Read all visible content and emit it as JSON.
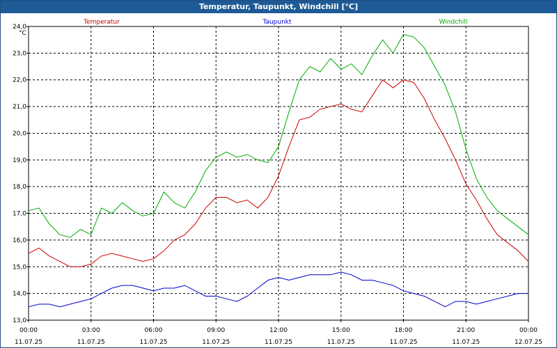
{
  "window": {
    "title": "Temperatur, Taupunkt, Windchill [°C]"
  },
  "colors": {
    "title_bg": "#1e5a96",
    "temperatur": "#cc0000",
    "taupunkt": "#0000cc",
    "windchill": "#00aa00",
    "grid": "#000000"
  },
  "chart_data": {
    "type": "line",
    "title": "Temperatur, Taupunkt, Windchill [°C]",
    "ylabel": "°C",
    "ylim": [
      13.0,
      24.0
    ],
    "yticks": [
      "13,0",
      "14,0",
      "15,0",
      "16,0",
      "17,0",
      "18,0",
      "19,0",
      "20,0",
      "21,0",
      "22,0",
      "23,0",
      "24,0"
    ],
    "yticks_values": [
      13,
      14,
      15,
      16,
      17,
      18,
      19,
      20,
      21,
      22,
      23,
      24
    ],
    "xlim": [
      0,
      24
    ],
    "xticks": [
      {
        "time": "00:00",
        "date": "11.07.25"
      },
      {
        "time": "03:00",
        "date": "11.07.25"
      },
      {
        "time": "06:00",
        "date": "11.07.25"
      },
      {
        "time": "09:00",
        "date": "11.07.25"
      },
      {
        "time": "12:00",
        "date": "11.07.25"
      },
      {
        "time": "15:00",
        "date": "11.07.25"
      },
      {
        "time": "18:00",
        "date": "11.07.25"
      },
      {
        "time": "21:00",
        "date": "11.07.25"
      },
      {
        "time": "00:00",
        "date": "12.07.25"
      }
    ],
    "xticks_values": [
      0,
      3,
      6,
      9,
      12,
      15,
      18,
      21,
      24
    ],
    "grid": true,
    "legend_placement": "top",
    "series": [
      {
        "name": "Temperatur",
        "x": [
          0,
          0.5,
          1,
          1.5,
          2,
          2.5,
          3,
          3.5,
          4,
          4.5,
          5,
          5.5,
          6,
          6.5,
          7,
          7.5,
          8,
          8.5,
          9,
          9.5,
          10,
          10.5,
          11,
          11.5,
          12,
          12.5,
          13,
          13.5,
          14,
          14.5,
          15,
          15.5,
          16,
          16.5,
          17,
          17.5,
          18,
          18.5,
          19,
          19.5,
          20,
          20.5,
          21,
          21.5,
          22,
          22.5,
          23,
          23.5,
          24
        ],
        "y": [
          15.5,
          15.7,
          15.4,
          15.2,
          15.0,
          15.0,
          15.1,
          15.4,
          15.5,
          15.4,
          15.3,
          15.2,
          15.3,
          15.6,
          16.0,
          16.2,
          16.6,
          17.2,
          17.6,
          17.6,
          17.4,
          17.5,
          17.2,
          17.6,
          18.4,
          19.5,
          20.5,
          20.6,
          20.9,
          21.0,
          21.1,
          20.9,
          20.8,
          21.4,
          22.0,
          21.7,
          22.0,
          21.9,
          21.3,
          20.5,
          19.8,
          19.0,
          18.1,
          17.5,
          16.8,
          16.2,
          15.9,
          15.6,
          15.2
        ]
      },
      {
        "name": "Taupunkt",
        "x": [
          0,
          0.5,
          1,
          1.5,
          2,
          2.5,
          3,
          3.5,
          4,
          4.5,
          5,
          5.5,
          6,
          6.5,
          7,
          7.5,
          8,
          8.5,
          9,
          9.5,
          10,
          10.5,
          11,
          11.5,
          12,
          12.5,
          13,
          13.5,
          14,
          14.5,
          15,
          15.5,
          16,
          16.5,
          17,
          17.5,
          18,
          18.5,
          19,
          19.5,
          20,
          20.5,
          21,
          21.5,
          22,
          22.5,
          23,
          23.5,
          24
        ],
        "y": [
          13.5,
          13.6,
          13.6,
          13.5,
          13.6,
          13.7,
          13.8,
          14.0,
          14.2,
          14.3,
          14.3,
          14.2,
          14.1,
          14.2,
          14.2,
          14.3,
          14.1,
          13.9,
          13.9,
          13.8,
          13.7,
          13.9,
          14.2,
          14.5,
          14.6,
          14.5,
          14.6,
          14.7,
          14.7,
          14.7,
          14.8,
          14.7,
          14.5,
          14.5,
          14.4,
          14.3,
          14.1,
          14.0,
          13.9,
          13.7,
          13.5,
          13.7,
          13.7,
          13.6,
          13.7,
          13.8,
          13.9,
          14.0,
          14.0
        ]
      },
      {
        "name": "Windchill",
        "x": [
          0,
          0.5,
          1,
          1.5,
          2,
          2.5,
          3,
          3.5,
          4,
          4.5,
          5,
          5.5,
          6,
          6.5,
          7,
          7.5,
          8,
          8.5,
          9,
          9.5,
          10,
          10.5,
          11,
          11.5,
          12,
          12.5,
          13,
          13.5,
          14,
          14.5,
          15,
          15.5,
          16,
          16.5,
          17,
          17.5,
          18,
          18.5,
          19,
          19.5,
          20,
          20.5,
          21,
          21.5,
          22,
          22.5,
          23,
          23.5,
          24
        ],
        "y": [
          17.1,
          17.2,
          16.6,
          16.2,
          16.1,
          16.4,
          16.2,
          17.2,
          17.0,
          17.4,
          17.1,
          16.9,
          17.0,
          17.8,
          17.4,
          17.2,
          17.8,
          18.6,
          19.1,
          19.3,
          19.1,
          19.2,
          19.0,
          18.9,
          19.5,
          20.8,
          22.0,
          22.5,
          22.3,
          22.8,
          22.4,
          22.6,
          22.2,
          22.9,
          23.5,
          23.0,
          23.7,
          23.6,
          23.2,
          22.5,
          21.8,
          20.8,
          19.4,
          18.3,
          17.6,
          17.1,
          16.8,
          16.5,
          16.2
        ]
      }
    ]
  }
}
